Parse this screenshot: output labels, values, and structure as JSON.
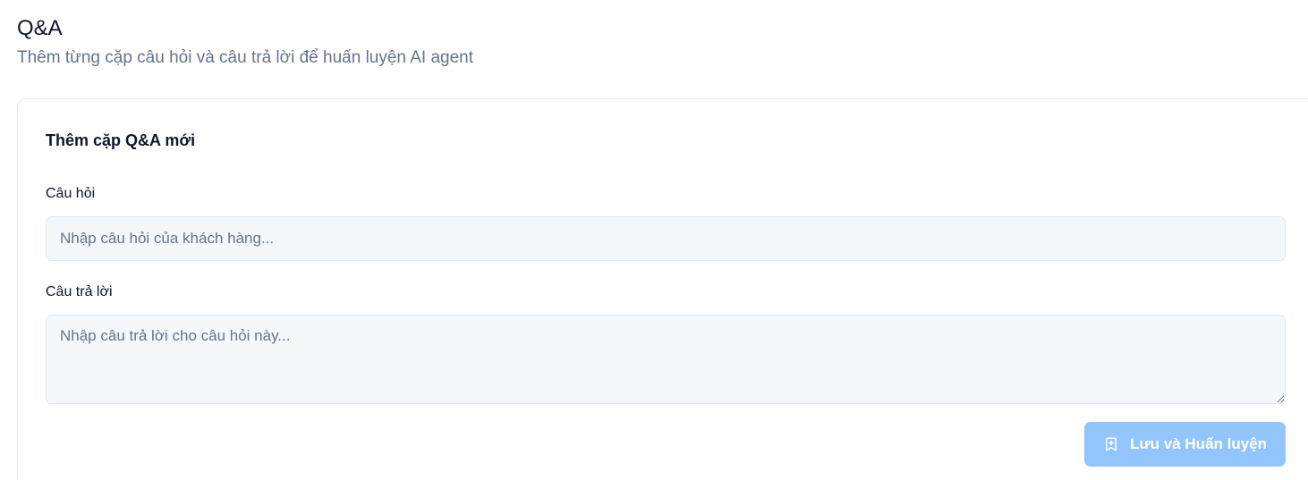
{
  "header": {
    "title": "Q&A",
    "subtitle": "Thêm từng cặp câu hỏi và câu trả lời để huấn luyện AI agent"
  },
  "form": {
    "title": "Thêm cặp Q&A mới",
    "question": {
      "label": "Câu hỏi",
      "value": "",
      "placeholder": "Nhập câu hỏi của khách hàng..."
    },
    "answer": {
      "label": "Câu trả lời",
      "value": "",
      "placeholder": "Nhập câu trả lời cho câu hỏi này..."
    },
    "submit": {
      "label": "Lưu và Huấn luyện",
      "icon": "bookmark-plus-icon",
      "disabled": true
    }
  },
  "colors": {
    "button_disabled_bg": "#93c5fd",
    "input_bg": "#f5f8fb",
    "border": "#e2e8f0",
    "muted_text": "#64748b"
  }
}
